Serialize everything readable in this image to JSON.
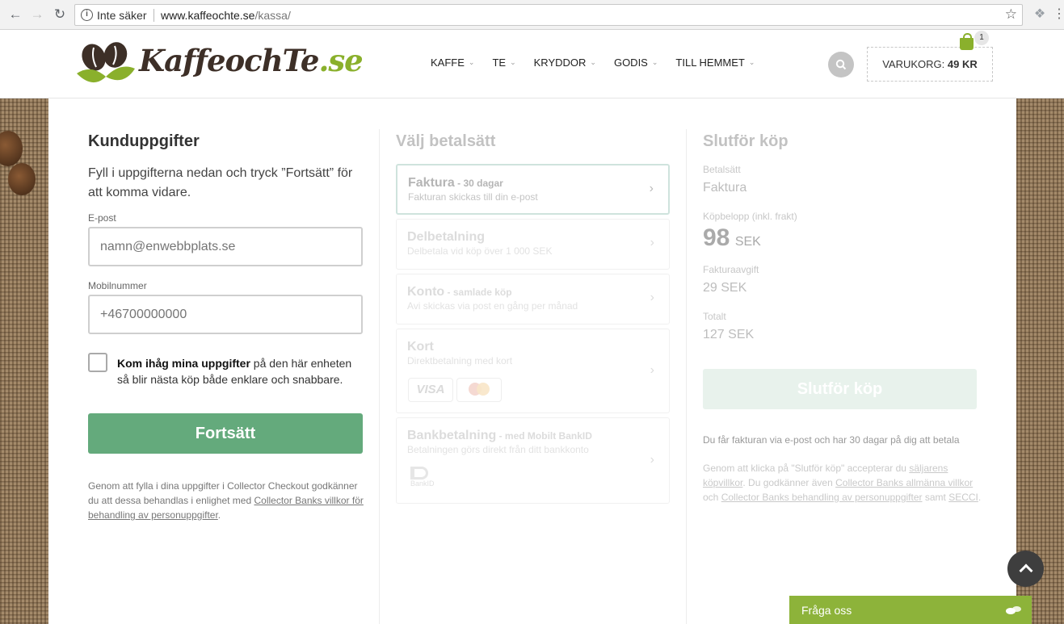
{
  "browser": {
    "security": "Inte säker",
    "url_host": "www.kaffeochte.se",
    "url_path": "/kassa/"
  },
  "header": {
    "logo_main": "KaffeochTe",
    "logo_tld": ".se",
    "nav": [
      "KAFFE",
      "TE",
      "KRYDDOR",
      "GODIS",
      "TILL HEMMET"
    ],
    "cart_label": "VARUKORG:",
    "cart_amount": "49 KR",
    "cart_count": "1",
    "accent_color": "#8ab02c"
  },
  "customer": {
    "title": "Kunduppgifter",
    "intro": "Fyll i uppgifterna nedan och tryck ”Fortsätt” för att komma vidare.",
    "email_label": "E-post",
    "email_placeholder": "namn@enwebbplats.se",
    "phone_label": "Mobilnummer",
    "phone_placeholder": "+46700000000",
    "remember_bold": "Kom ihåg mina uppgifter",
    "remember_rest": " på den här enheten så blir nästa köp både enklare och snabbare.",
    "remember_checked": false,
    "continue": "Fortsätt",
    "legal_text": "Genom att fylla i dina uppgifter i Collector Checkout godkänner du att dessa behandlas i enlighet med ",
    "legal_link": "Collector Banks villkor för behandling av personuppgifter",
    "legal_end": "."
  },
  "payment": {
    "title": "Välj betalsätt",
    "options": [
      {
        "name": "Faktura",
        "sub": " - 30 dagar",
        "desc": "Fakturan skickas till din e-post"
      },
      {
        "name": "Delbetalning",
        "sub": "",
        "desc": "Delbetala vid köp över 1 000 SEK"
      },
      {
        "name": "Konto",
        "sub": " - samlade köp",
        "desc": "Avi skickas via post en gång per månad"
      },
      {
        "name": "Kort",
        "sub": "",
        "desc": "Direktbetalning med kort",
        "card_visa": "VISA"
      },
      {
        "name": "Bankbetalning",
        "sub": " - med Mobilt BankID",
        "desc": "Betalningen görs direkt från ditt bankkonto",
        "bankid_label": "BankID"
      }
    ]
  },
  "summary": {
    "title": "Slutför köp",
    "method_label": "Betalsätt",
    "method_value": "Faktura",
    "amount_label": "Köpbelopp (inkl. frakt)",
    "amount_value": "98",
    "amount_currency": "SEK",
    "fee_label": "Fakturaavgift",
    "fee_value": "29 SEK",
    "total_label": "Totalt",
    "total_value": "127 SEK",
    "finish": "Slutför köp",
    "note": "Du får fakturan via e-post och har 30 dagar på dig att betala",
    "legal_1": "Genom att klicka på \"Slutför köp\" accepterar du ",
    "legal_link_1": "säljarens köpvillkor",
    "legal_2": ". Du godkänner även ",
    "legal_link_2": "Collector Banks allmänna villkor",
    "legal_3": " och ",
    "legal_link_3": "Collector Banks behandling av personuppgifter",
    "legal_4": " samt ",
    "legal_link_4": "SECCI",
    "legal_5": "."
  },
  "chat": {
    "label": "Fråga oss"
  }
}
